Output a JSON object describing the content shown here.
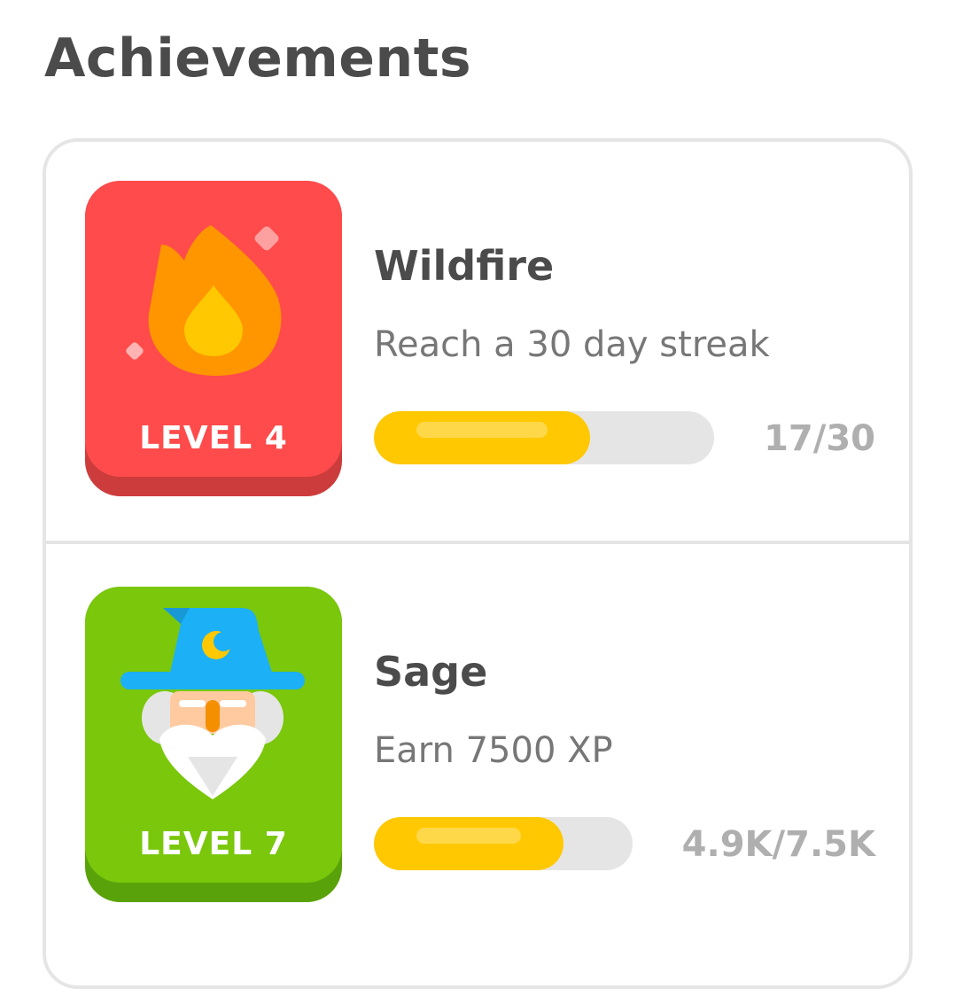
{
  "page": {
    "title": "Achievements"
  },
  "achievements": [
    {
      "title": "Wildfire",
      "description": "Reach a 30 day streak",
      "level_label": "LEVEL 4",
      "progress_text": "17/30",
      "progress_fraction": 0.567,
      "badge_icon": "flame-icon",
      "badge_color": "#ff4b4b",
      "badge_shadow_color": "#cc3c3c"
    },
    {
      "title": "Sage",
      "description": "Earn 7500 XP",
      "level_label": "LEVEL 7",
      "progress_text": "4.9K/7.5K",
      "progress_fraction": 0.653,
      "badge_icon": "wizard-icon",
      "badge_color": "#7ac70c",
      "badge_shadow_color": "#5aa20a"
    }
  ],
  "colors": {
    "progress_fill": "#ffc800",
    "progress_track": "#e5e5e5",
    "title_text": "#4b4b4b",
    "muted_text": "#777777",
    "count_text": "#afafaf"
  }
}
